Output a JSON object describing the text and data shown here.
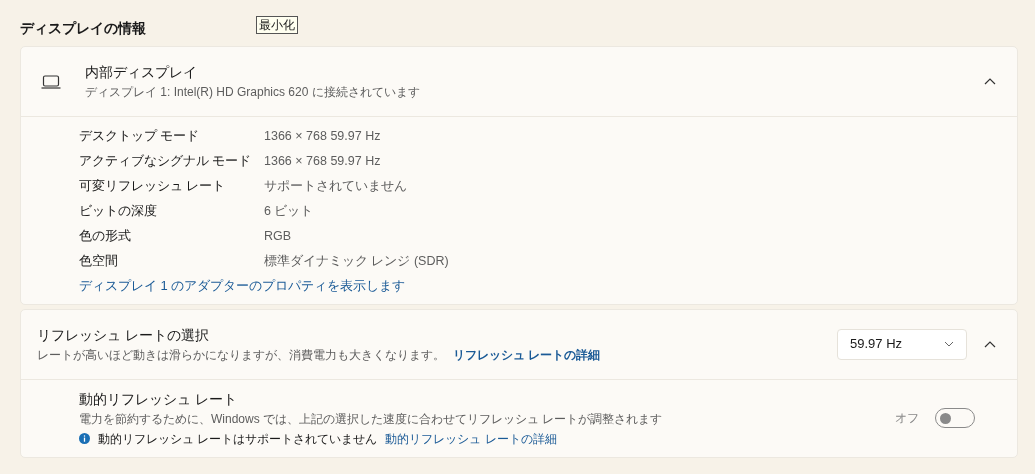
{
  "section_title": "ディスプレイの情報",
  "tooltip": "最小化",
  "display_card": {
    "title": "内部ディスプレイ",
    "subtitle": "ディスプレイ 1: Intel(R) HD Graphics 620 に接続されています",
    "expanded": true,
    "properties": [
      {
        "label": "デスクトップ モード",
        "value": "1366 × 768 59.97 Hz"
      },
      {
        "label": "アクティブなシグナル モード",
        "value": "1366 × 768 59.97 Hz"
      },
      {
        "label": "可変リフレッシュ レート",
        "value": "サポートされていません"
      },
      {
        "label": "ビットの深度",
        "value": "6 ビット"
      },
      {
        "label": "色の形式",
        "value": "RGB"
      },
      {
        "label": "色空間",
        "value": "標準ダイナミック レンジ (SDR)"
      }
    ],
    "link": "ディスプレイ 1 のアダプターのプロパティを表示します"
  },
  "refresh_card": {
    "title": "リフレッシュ レートの選択",
    "description": "レートが高いほど動きは滑らかになりますが、消費電力も大きくなります。",
    "link": "リフレッシュ レートの詳細",
    "dropdown_value": "59.97 Hz",
    "expanded": true,
    "dynamic": {
      "title": "動的リフレッシュ レート",
      "description": "電力を節約するために、Windows では、上記の選択した速度に合わせてリフレッシュ レートが調整されます",
      "info": "動的リフレッシュ レートはサポートされていません",
      "link": "動的リフレッシュ レートの詳細",
      "toggle_label": "オフ",
      "on": false
    }
  }
}
